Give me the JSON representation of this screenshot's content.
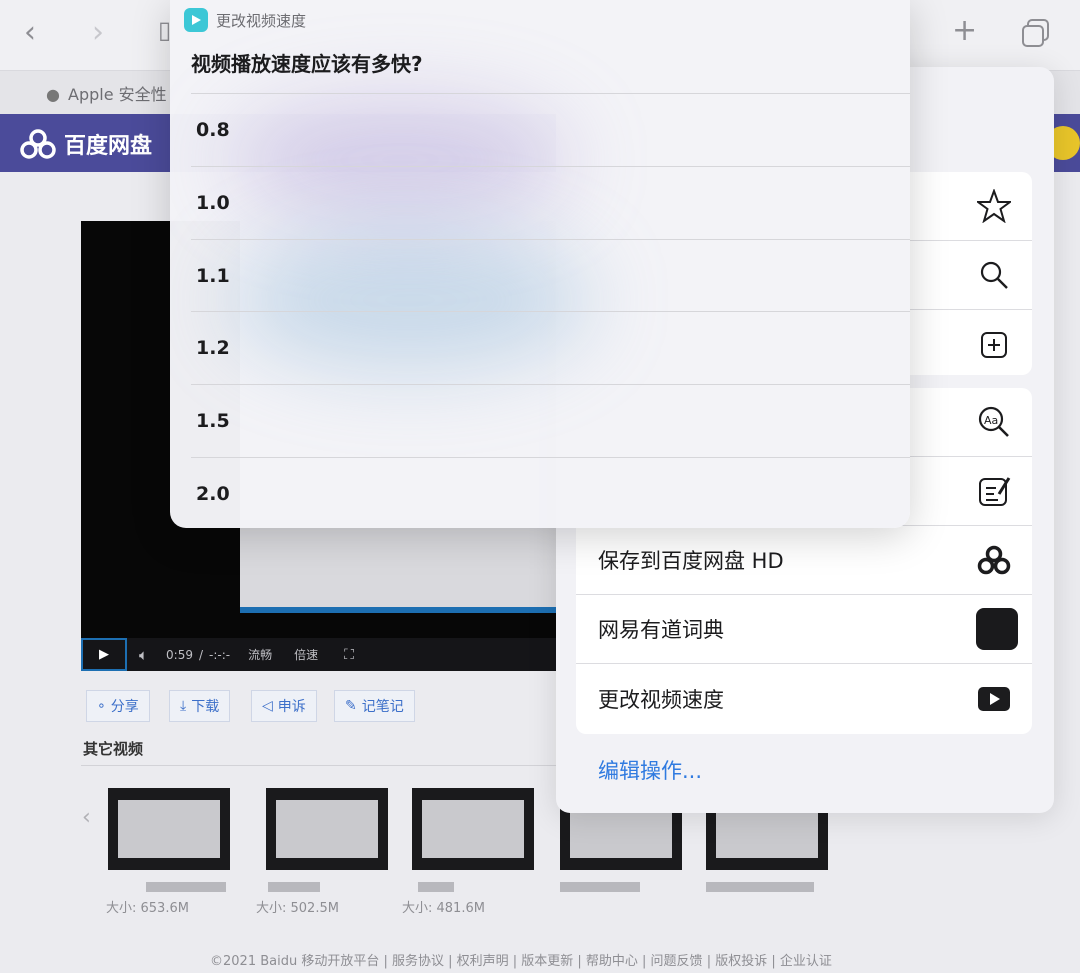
{
  "browser": {
    "bookmark": "Apple 安全性"
  },
  "page": {
    "logo_text": "百度网盘",
    "player": {
      "time": "0:59",
      "time_sep": "/",
      "duration": "-:-:-",
      "quality": "流畅",
      "speed": "倍速"
    },
    "actions": [
      "分享",
      "下载",
      "申诉",
      "记笔记"
    ],
    "other_videos_title": "其它视频",
    "thumbs": [
      {
        "size": "大小: 653.6M"
      },
      {
        "size": "大小: 502.5M"
      },
      {
        "size": "大小: 481.6M"
      }
    ],
    "footer": "©2021 Baidu  移动开放平台 | 服务协议 | 权利声明 | 版本更新 | 帮助中心 | 问题反馈 | 版权投诉 | 企业认证"
  },
  "share_sheet": {
    "rows": [
      {
        "label": "保存到百度网盘 HD",
        "icon": "baidu-cloud-icon"
      },
      {
        "label": "网易有道词典",
        "icon": "youdao-icon"
      },
      {
        "label": "更改视频速度",
        "icon": "play-icon"
      }
    ],
    "edit_actions": "编辑操作..."
  },
  "dialog": {
    "app_name": "更改视频速度",
    "question": "视频播放速度应该有多快?",
    "options": [
      "0.8",
      "1.0",
      "1.1",
      "1.2",
      "1.5",
      "2.0"
    ]
  }
}
